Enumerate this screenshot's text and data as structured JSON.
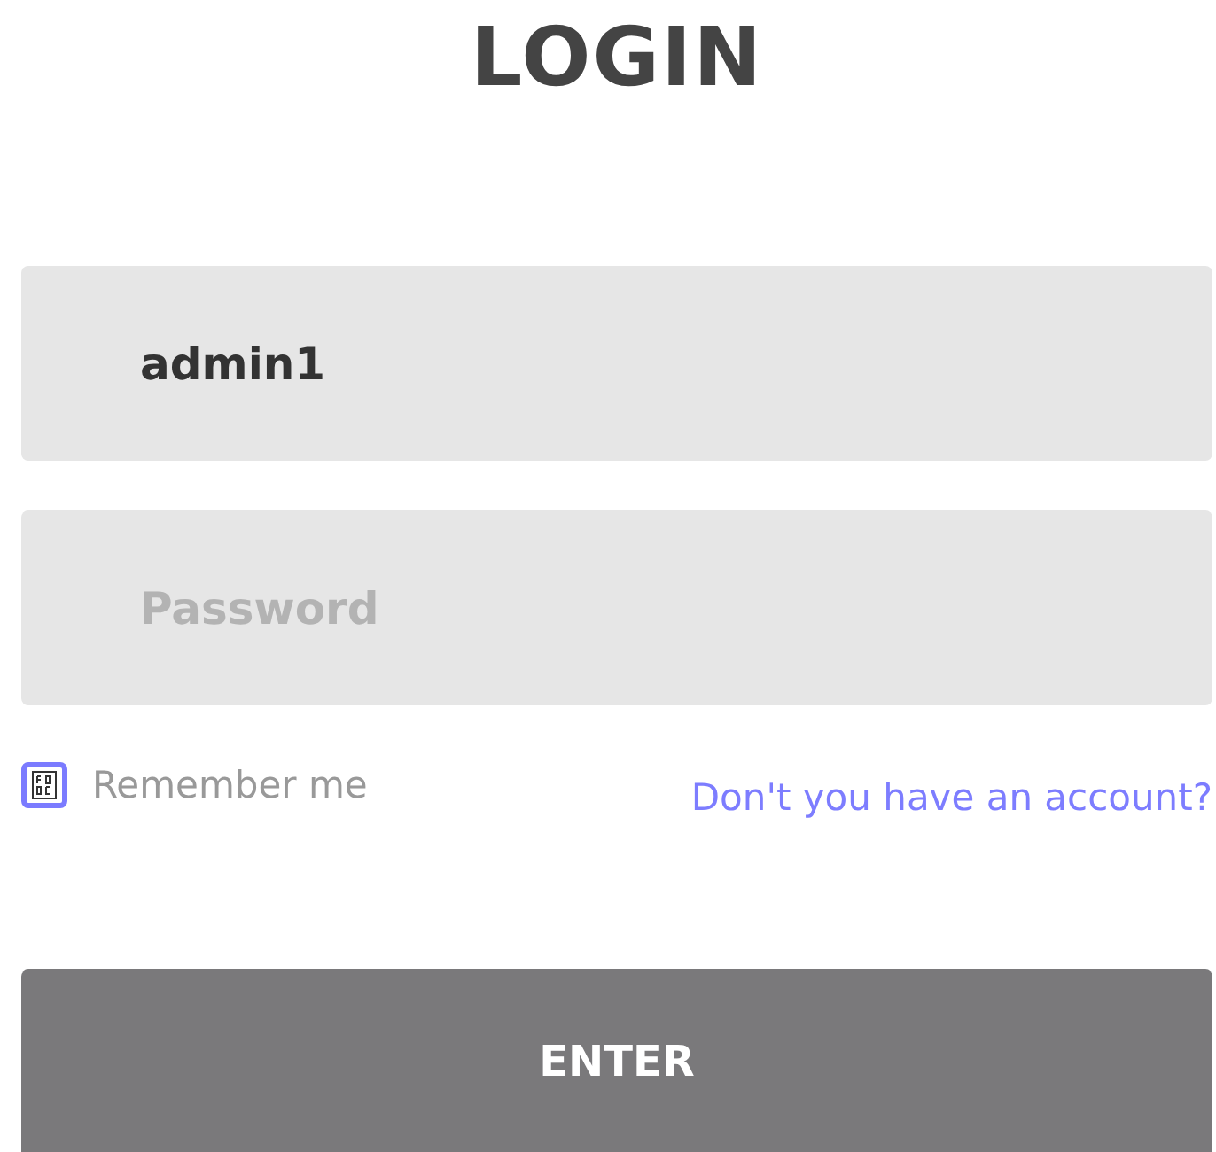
{
  "title": "LOGIN",
  "username": {
    "value": "admin1"
  },
  "password": {
    "placeholder": "Password"
  },
  "remember": {
    "label": "Remember me",
    "checked": true
  },
  "signup_link": "Don't you have an account?",
  "button": "ENTER"
}
